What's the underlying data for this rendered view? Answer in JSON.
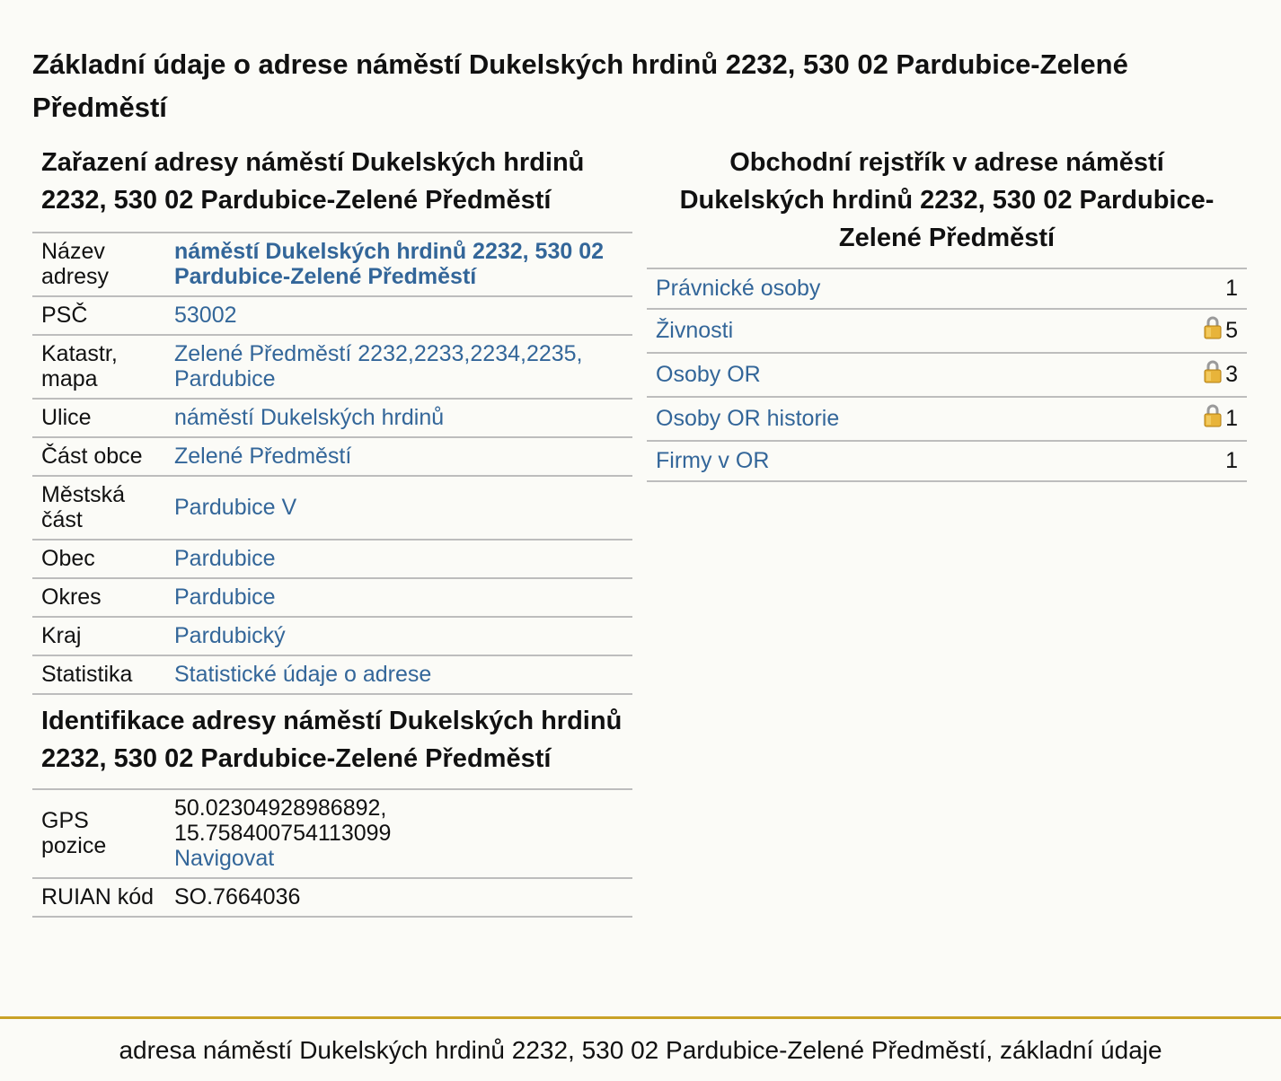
{
  "page": {
    "title": "Základní údaje o adrese náměstí Dukelských hrdinů 2232, 530 02 Pardubice-Zelené Předměstí"
  },
  "classification": {
    "heading": "Zařazení adresy náměstí Dukelských hrdinů 2232, 530 02 Pardubice-Zelené Předměstí",
    "rows": [
      {
        "label": "Název adresy",
        "value": "náměstí Dukelských hrdinů 2232, 530 02 Pardubice-Zelené Předměstí"
      },
      {
        "label": "PSČ",
        "value": "53002"
      },
      {
        "label": "Katastr, mapa",
        "value": "Zelené Předměstí 2232,2233,2234,2235, Pardubice"
      },
      {
        "label": "Ulice",
        "value": "náměstí Dukelských hrdinů"
      },
      {
        "label": "Část obce",
        "value": "Zelené Předměstí"
      },
      {
        "label": "Městská část",
        "value": "Pardubice V"
      },
      {
        "label": "Obec",
        "value": "Pardubice"
      },
      {
        "label": "Okres",
        "value": "Pardubice"
      },
      {
        "label": "Kraj",
        "value": "Pardubický"
      },
      {
        "label": "Statistika",
        "value": "Statistické údaje o adrese"
      }
    ]
  },
  "identification": {
    "heading": "Identifikace adresy náměstí Dukelských hrdinů 2232, 530 02 Pardubice-Zelené Předměstí",
    "gps_label": "GPS pozice",
    "gps_lat": "50.02304928986892,",
    "gps_lon": "15.758400754113099",
    "navigate_label": "Navigovat",
    "ruian_label": "RUIAN kód",
    "ruian_value": "SO.7664036"
  },
  "business_register": {
    "heading": "Obchodní rejstřík v adrese náměstí Dukelských hrdinů 2232, 530 02 Pardubice-Zelené Předměstí",
    "rows": [
      {
        "label": "Právnické osoby",
        "count": "1",
        "locked": false
      },
      {
        "label": "Živnosti",
        "count": "5",
        "locked": true
      },
      {
        "label": "Osoby OR",
        "count": "3",
        "locked": true
      },
      {
        "label": "Osoby OR historie",
        "count": "1",
        "locked": true
      },
      {
        "label": "Firmy v OR",
        "count": "1",
        "locked": false
      }
    ]
  },
  "footer": {
    "text": "adresa náměstí Dukelských hrdinů 2232, 530 02 Pardubice-Zelené Předměstí, základní údaje"
  },
  "colors": {
    "background": "#fbfbf7",
    "link": "#336699",
    "row_border": "#bdbdbd",
    "footer_accent": "#c9a227",
    "lock_gold": "#e8b43a"
  }
}
